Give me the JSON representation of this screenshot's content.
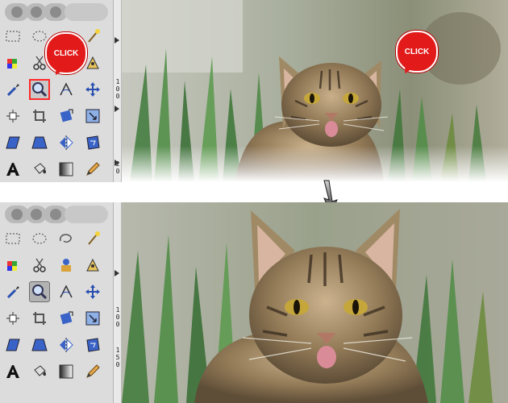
{
  "annotations": {
    "click_label": "CLICK"
  },
  "ruler_marks_top": [
    "1",
    "0",
    "0",
    "2",
    "0"
  ],
  "ruler_marks_bottom": [
    "1",
    "0",
    "0",
    "1",
    "5",
    "0"
  ],
  "tools": [
    {
      "name": "rect-select"
    },
    {
      "name": "ellipse-select"
    },
    {
      "name": "free-select"
    },
    {
      "name": "fuzzy-select"
    },
    {
      "name": "color-select"
    },
    {
      "name": "scissors-select"
    },
    {
      "name": "foreground-select"
    },
    {
      "name": "paths"
    },
    {
      "name": "color-picker"
    },
    {
      "name": "zoom"
    },
    {
      "name": "measure"
    },
    {
      "name": "move"
    },
    {
      "name": "align"
    },
    {
      "name": "crop"
    },
    {
      "name": "rotate"
    },
    {
      "name": "scale"
    },
    {
      "name": "shear"
    },
    {
      "name": "perspective"
    },
    {
      "name": "flip"
    },
    {
      "name": "cage"
    },
    {
      "name": "text"
    },
    {
      "name": "bucket-fill"
    },
    {
      "name": "blend"
    },
    {
      "name": "pencil"
    }
  ],
  "colors": {
    "highlight": "#ff2a2a",
    "bubble": "#e21a1a",
    "toolbox_bg": "#dcdcdc"
  }
}
